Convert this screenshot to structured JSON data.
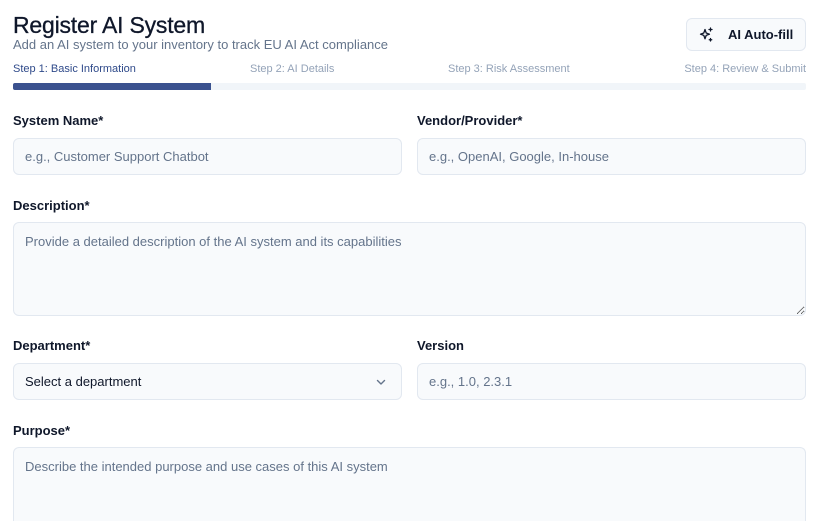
{
  "header": {
    "title": "Register AI System",
    "subtitle": "Add an AI system to your inventory to track EU AI Act compliance",
    "autofill_label": "AI Auto-fill",
    "autofill_icon": "sparkles-icon"
  },
  "steps": [
    {
      "label": "Step 1: Basic Information",
      "active": true
    },
    {
      "label": "Step 2: AI Details",
      "active": false
    },
    {
      "label": "Step 3: Risk Assessment",
      "active": false
    },
    {
      "label": "Step 4: Review & Submit",
      "active": false
    }
  ],
  "progress": {
    "fraction": 0.25
  },
  "form": {
    "system_name": {
      "label": "System Name*",
      "value": "",
      "placeholder": "e.g., Customer Support Chatbot"
    },
    "vendor": {
      "label": "Vendor/Provider*",
      "value": "",
      "placeholder": "e.g., OpenAI, Google, In-house"
    },
    "description": {
      "label": "Description*",
      "value": "",
      "placeholder": "Provide a detailed description of the AI system and its capabilities"
    },
    "department": {
      "label": "Department*",
      "selected": "Select a department",
      "icon": "chevron-down-icon"
    },
    "version": {
      "label": "Version",
      "value": "",
      "placeholder": "e.g., 1.0, 2.3.1"
    },
    "purpose": {
      "label": "Purpose*",
      "value": "",
      "placeholder": "Describe the intended purpose and use cases of this AI system"
    }
  },
  "colors": {
    "accent": "#3b528f",
    "active_step": "#2f4a8a",
    "inactive_step": "#94a3b8",
    "input_bg": "#f8fafc",
    "border": "#e2e8f0"
  }
}
